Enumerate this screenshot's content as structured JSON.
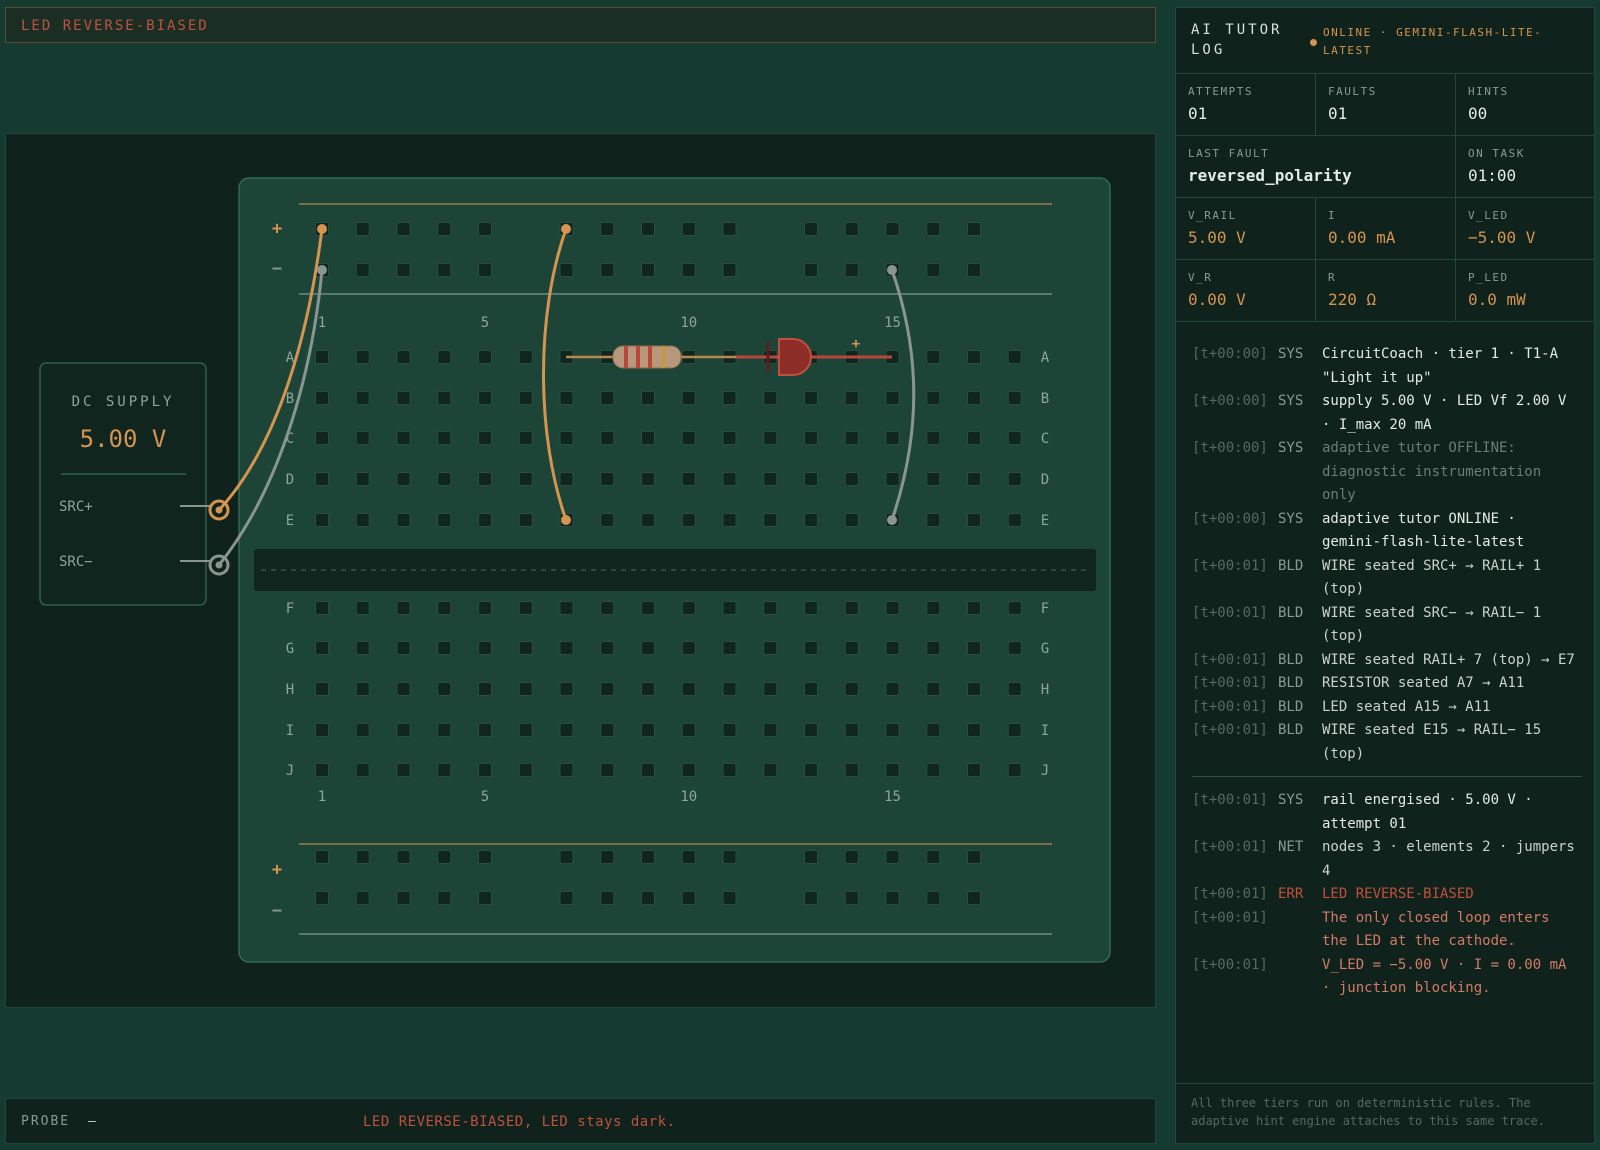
{
  "status_banner": "LED REVERSE-BIASED",
  "workbench": {
    "supply": {
      "title": "DC SUPPLY",
      "voltage": "5.00 V",
      "pos_label": "SRC+",
      "neg_label": "SRC−"
    },
    "breadboard": {
      "rows_top": [
        "A",
        "B",
        "C",
        "D",
        "E"
      ],
      "rows_bottom": [
        "F",
        "G",
        "H",
        "I",
        "J"
      ],
      "column_numbers": [
        "1",
        "5",
        "10",
        "15"
      ],
      "rail_plus": "+",
      "rail_minus": "−"
    }
  },
  "probe": {
    "label": "PROBE",
    "value": "—",
    "message": "LED REVERSE-BIASED, LED stays dark."
  },
  "tutor": {
    "title": "AI TUTOR LOG",
    "status": "ONLINE · GEMINI-FLASH-LITE-LATEST",
    "attempts_label": "ATTEMPTS",
    "attempts": "01",
    "faults_label": "FAULTS",
    "faults": "01",
    "hints_label": "HINTS",
    "hints": "00",
    "last_fault_label": "LAST FAULT",
    "last_fault": "reversed_polarity",
    "on_task_label": "ON TASK",
    "on_task": "01:00",
    "v_rail_label": "V_RAIL",
    "v_rail": "5.00 V",
    "i_label": "I",
    "i": "0.00 mA",
    "v_led_label": "V_LED",
    "v_led": "−5.00 V",
    "v_r_label": "V_R",
    "v_r": "0.00 V",
    "r_label": "R",
    "r": "220 Ω",
    "p_led_label": "P_LED",
    "p_led": "0.0 mW",
    "log_before": [
      {
        "ts": "[t+00:00]",
        "tag": "SYS",
        "msg": "CircuitCoach · tier 1 · T1-A \"Light it up\"",
        "kind": "sys"
      },
      {
        "ts": "[t+00:00]",
        "tag": "SYS",
        "msg": "supply 5.00 V · LED Vf 2.00 V · I_max 20 mA",
        "kind": "sys"
      },
      {
        "ts": "[t+00:00]",
        "tag": "SYS",
        "msg": "adaptive tutor OFFLINE: diagnostic instrumentation only",
        "kind": "muted"
      },
      {
        "ts": "[t+00:00]",
        "tag": "SYS",
        "msg": "adaptive tutor ONLINE · gemini-flash-lite-latest",
        "kind": "sys"
      },
      {
        "ts": "[t+00:01]",
        "tag": "BLD",
        "msg": "WIRE seated SRC+ → RAIL+ 1 (top)",
        "kind": "build"
      },
      {
        "ts": "[t+00:01]",
        "tag": "BLD",
        "msg": "WIRE seated SRC− → RAIL− 1 (top)",
        "kind": "build"
      },
      {
        "ts": "[t+00:01]",
        "tag": "BLD",
        "msg": "WIRE seated RAIL+ 7 (top) → E7",
        "kind": "build"
      },
      {
        "ts": "[t+00:01]",
        "tag": "BLD",
        "msg": "RESISTOR seated A7 → A11",
        "kind": "build"
      },
      {
        "ts": "[t+00:01]",
        "tag": "BLD",
        "msg": "LED seated A15 → A11",
        "kind": "build"
      },
      {
        "ts": "[t+00:01]",
        "tag": "BLD",
        "msg": "WIRE seated E15 → RAIL− 15 (top)",
        "kind": "build"
      }
    ],
    "log_after": [
      {
        "ts": "[t+00:01]",
        "tag": "SYS",
        "msg": "rail energised · 5.00 V · attempt 01",
        "kind": "sys"
      },
      {
        "ts": "[t+00:01]",
        "tag": "NET",
        "msg": "nodes 3 · elements 2 · jumpers 4",
        "kind": "build"
      },
      {
        "ts": "[t+00:01]",
        "tag": "ERR",
        "msg": "LED REVERSE-BIASED",
        "kind": "err"
      },
      {
        "ts": "[t+00:01]",
        "tag": "",
        "msg": "The only closed loop enters the LED at the cathode.",
        "kind": "errtext"
      },
      {
        "ts": "[t+00:01]",
        "tag": "",
        "msg": "V_LED = −5.00 V · I = 0.00 mA · junction blocking.",
        "kind": "errtext"
      }
    ],
    "footer": "All three tiers run on deterministic rules. The adaptive hint engine attaches to this same trace."
  },
  "colors": {
    "accent_orange": "#d5944f",
    "error_red": "#c0503e",
    "wire_gray": "#8a9590",
    "board_green": "#1c4538"
  }
}
